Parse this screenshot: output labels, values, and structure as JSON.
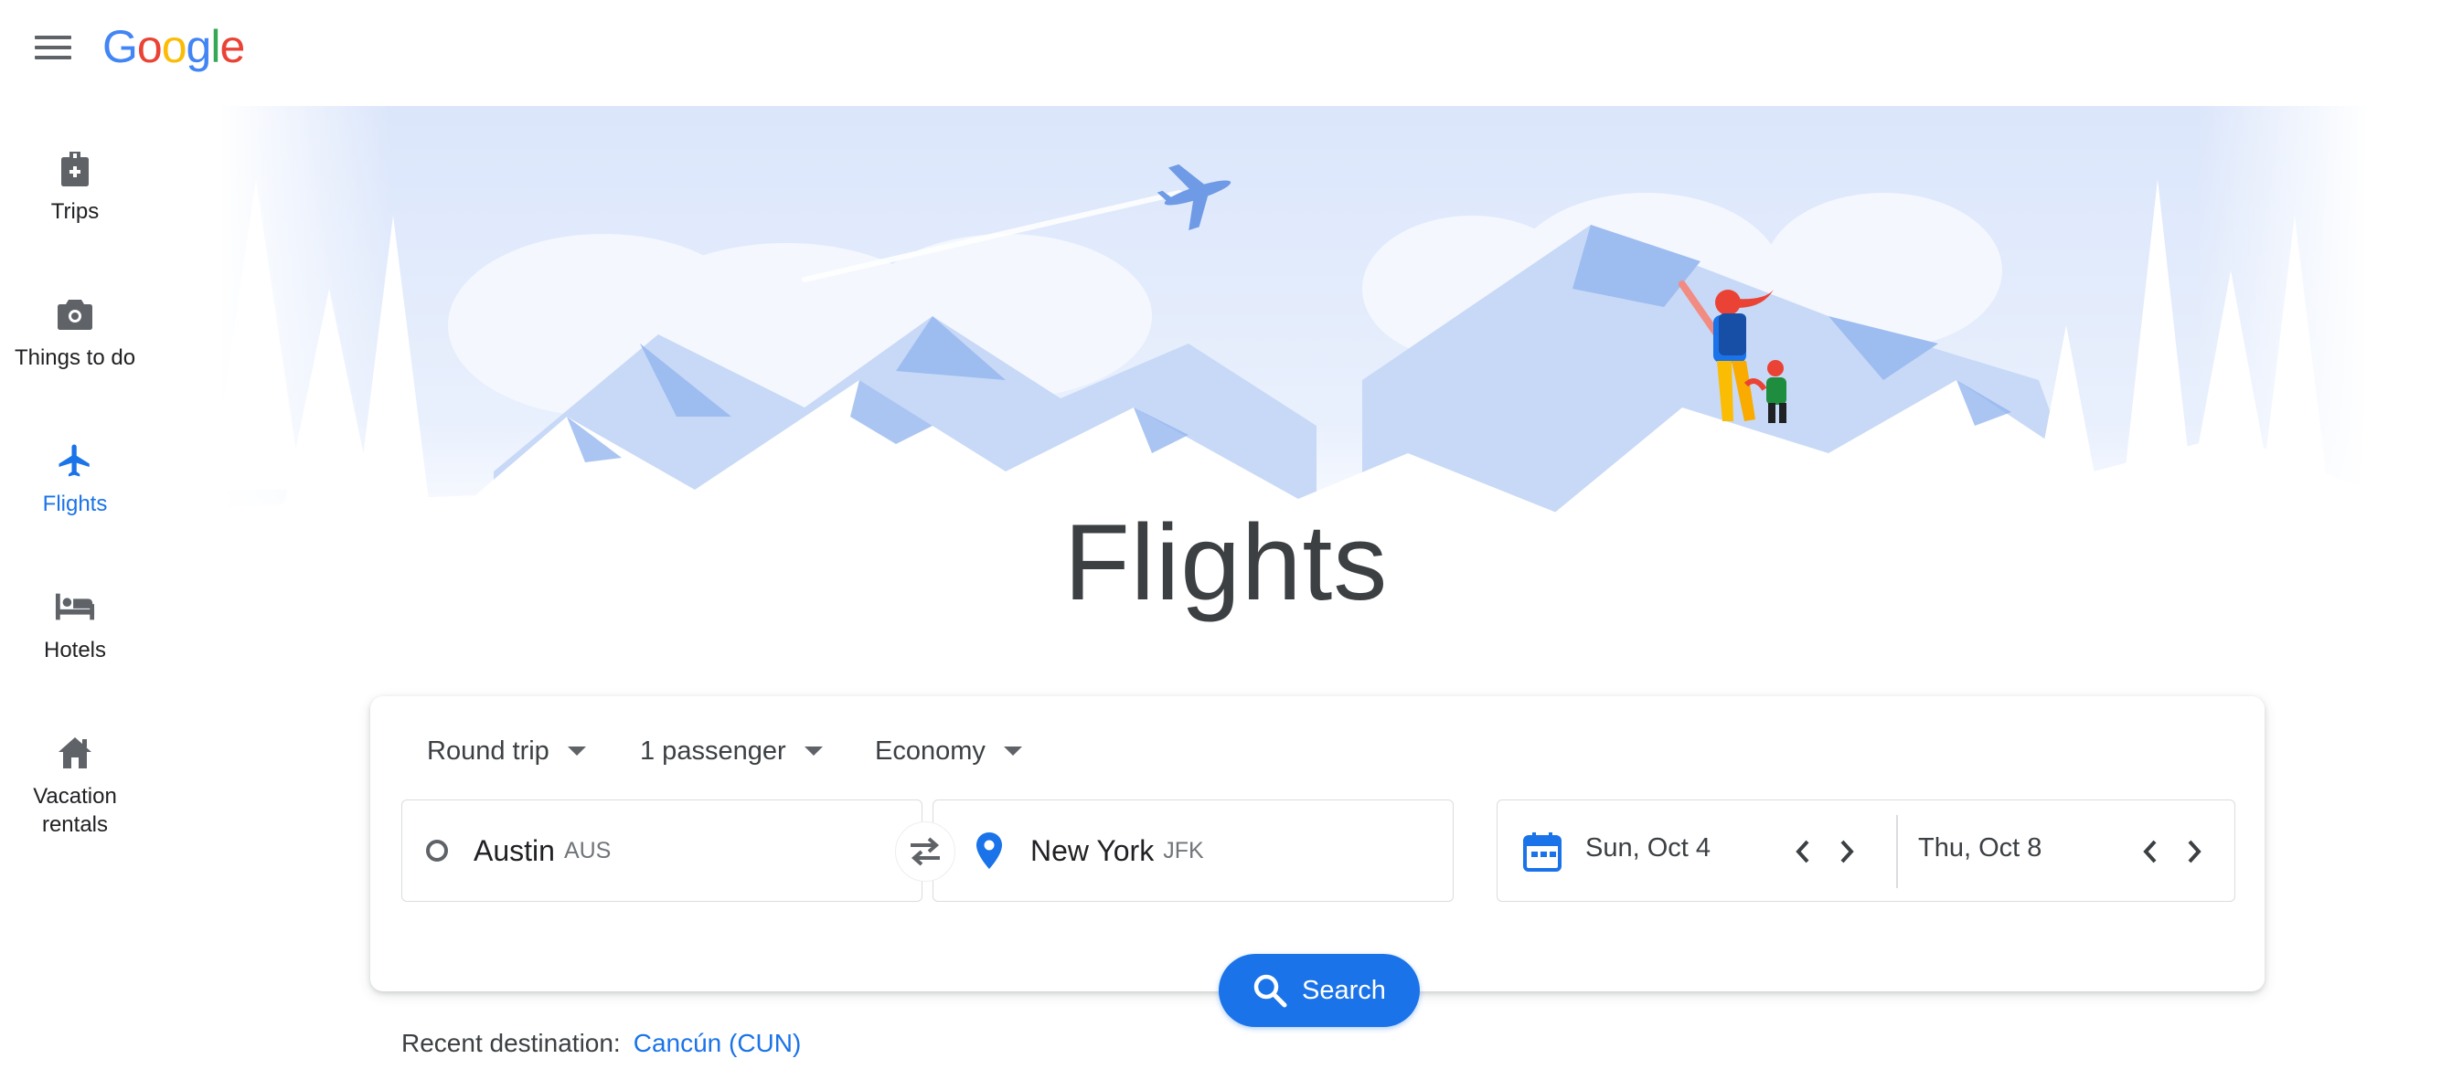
{
  "brand": {
    "logo_letters": [
      "G",
      "o",
      "o",
      "g",
      "l",
      "e"
    ]
  },
  "sidebar": {
    "items": [
      {
        "label": "Trips",
        "icon": "luggage-tag-icon",
        "active": false
      },
      {
        "label": "Things to do",
        "icon": "camera-icon",
        "active": false
      },
      {
        "label": "Flights",
        "icon": "airplane-icon",
        "active": true
      },
      {
        "label": "Hotels",
        "icon": "bed-icon",
        "active": false
      },
      {
        "label": "Vacation rentals",
        "icon": "house-icon",
        "active": false
      }
    ]
  },
  "hero": {
    "title": "Flights"
  },
  "search": {
    "trip_type": "Round trip",
    "passengers": "1 passenger",
    "cabin": "Economy",
    "origin": {
      "city": "Austin",
      "code": "AUS"
    },
    "destination": {
      "city": "New York",
      "code": "JFK"
    },
    "depart_date": "Sun, Oct 4",
    "return_date": "Thu, Oct 8",
    "button_label": "Search"
  },
  "recent": {
    "label": "Recent destination:",
    "link": "Cancún (CUN)"
  },
  "colors": {
    "accent": "#1a73e8",
    "hero_light": "#e8effd",
    "hero_mid": "#c6d8f7",
    "hero_dark": "#8fb2ee"
  }
}
